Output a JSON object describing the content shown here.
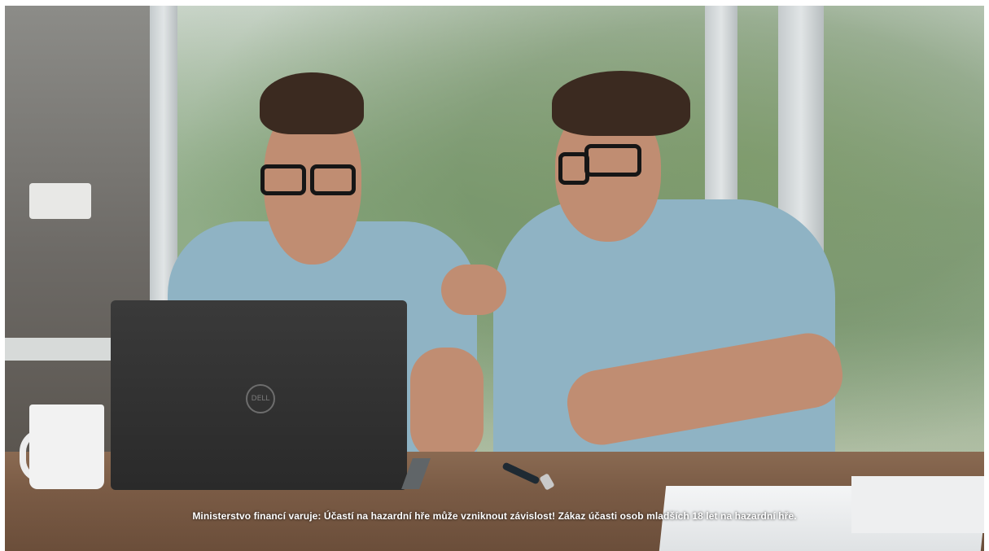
{
  "video": {
    "disclaimer_text": "Ministerstvo financí varuje: Účastí na hazardní hře může vzniknout závislost! Zákaz účasti osob mladších 18 let na hazardní hře.",
    "laptop_logo_text": "DELL"
  },
  "colors": {
    "shirt": "#8fb3c4",
    "table": "#7a5b45",
    "caption_text": "#ffffff"
  }
}
